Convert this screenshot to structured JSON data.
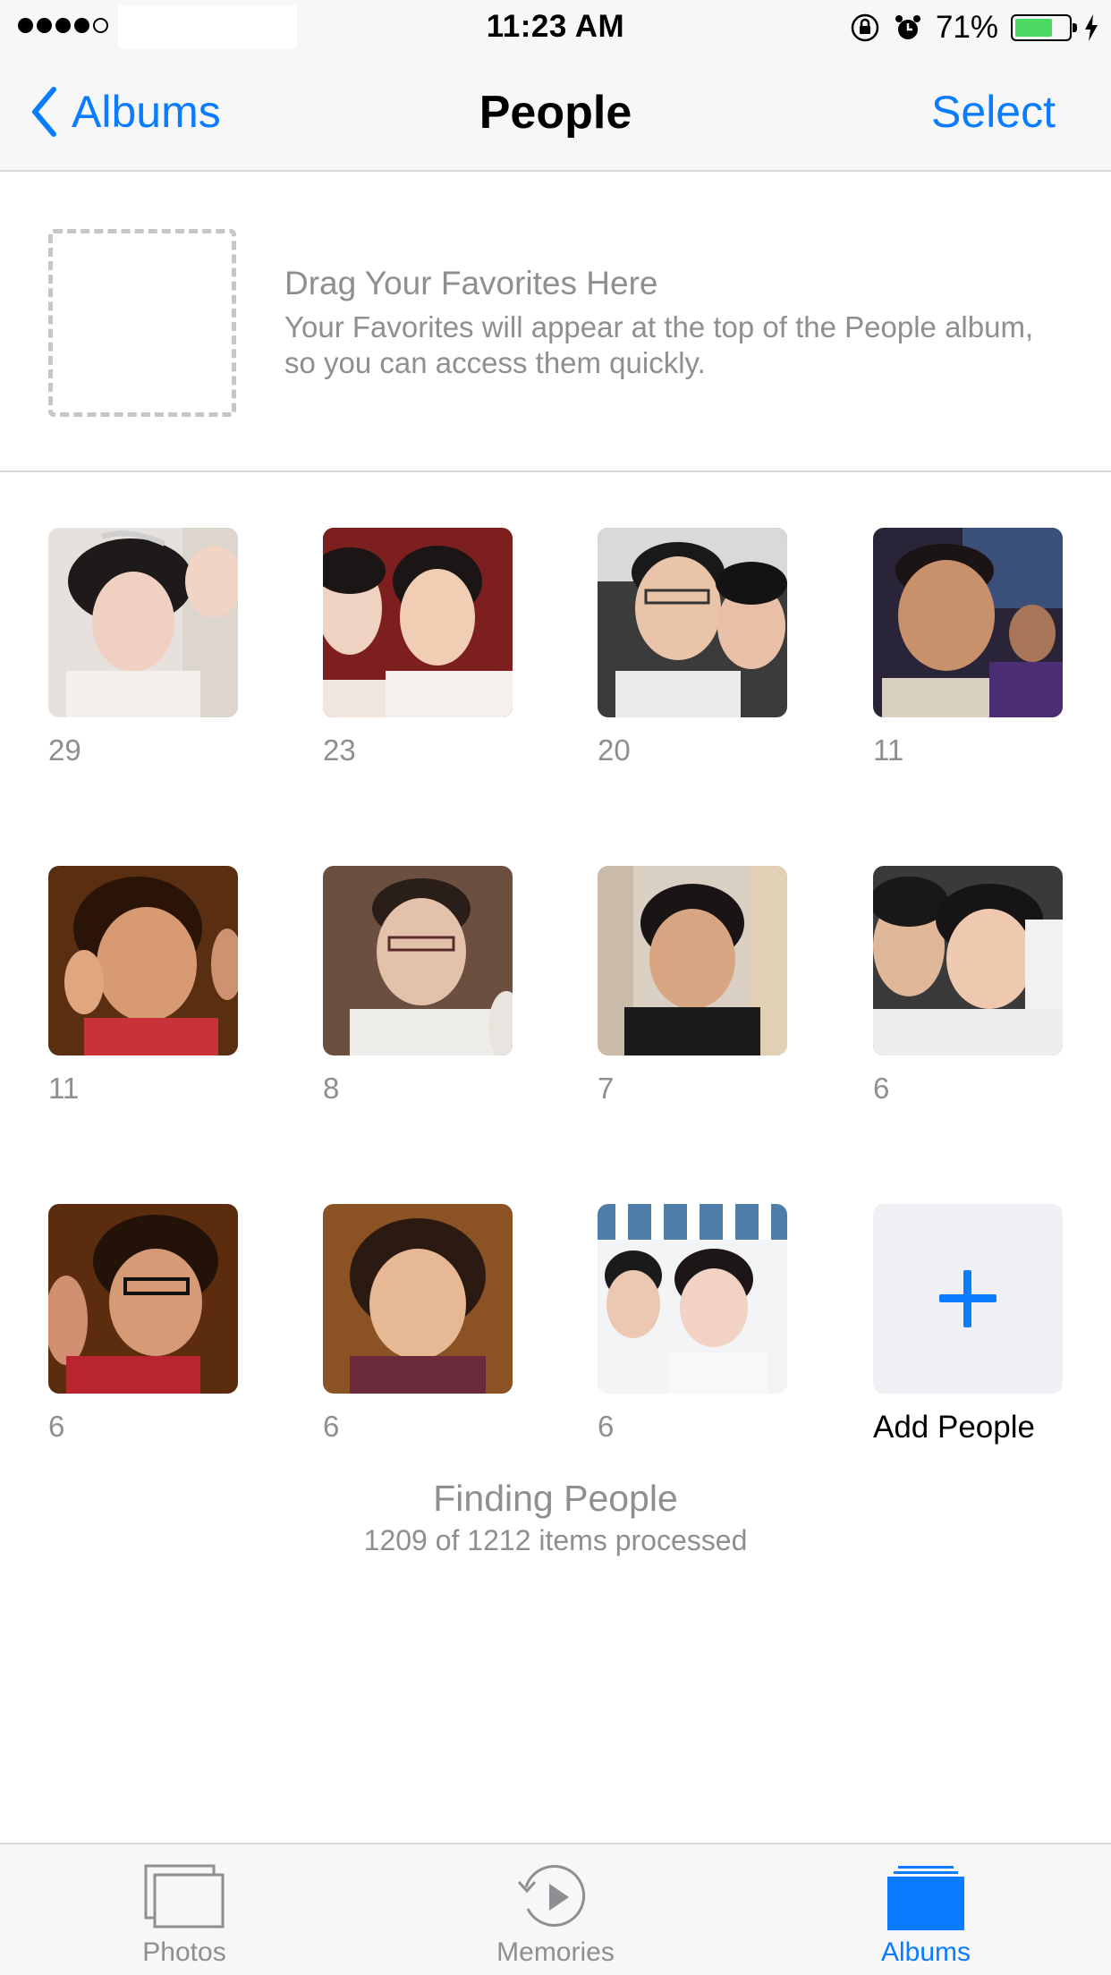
{
  "status_bar": {
    "time": "11:23 AM",
    "battery_percent": "71%",
    "battery_level": 0.71,
    "signal_filled_dots": 4,
    "signal_total_dots": 5,
    "icons": [
      "orientation-lock-icon",
      "alarm-icon",
      "battery-icon",
      "charging-bolt-icon"
    ]
  },
  "nav": {
    "back_label": "Albums",
    "title": "People",
    "select_label": "Select"
  },
  "favorites": {
    "title": "Drag Your Favorites Here",
    "description": "Your Favorites will appear at the top of the People album, so you can access them quickly."
  },
  "people": [
    {
      "count": "29"
    },
    {
      "count": "23"
    },
    {
      "count": "20"
    },
    {
      "count": "11"
    },
    {
      "count": "11"
    },
    {
      "count": "8"
    },
    {
      "count": "7"
    },
    {
      "count": "6"
    },
    {
      "count": "6"
    },
    {
      "count": "6"
    },
    {
      "count": "6"
    }
  ],
  "add_people": {
    "label": "Add People"
  },
  "progress": {
    "title": "Finding People",
    "detail": "1209 of 1212 items processed"
  },
  "tabs": [
    {
      "label": "Photos",
      "icon": "photos-tab-icon",
      "active": false
    },
    {
      "label": "Memories",
      "icon": "memories-tab-icon",
      "active": false
    },
    {
      "label": "Albums",
      "icon": "albums-tab-icon",
      "active": true
    }
  ],
  "colors": {
    "accent": "#0a7cff",
    "secondary_text": "#8e8e93",
    "battery_fill": "#4cd964",
    "bar_background": "#f7f7f7"
  }
}
